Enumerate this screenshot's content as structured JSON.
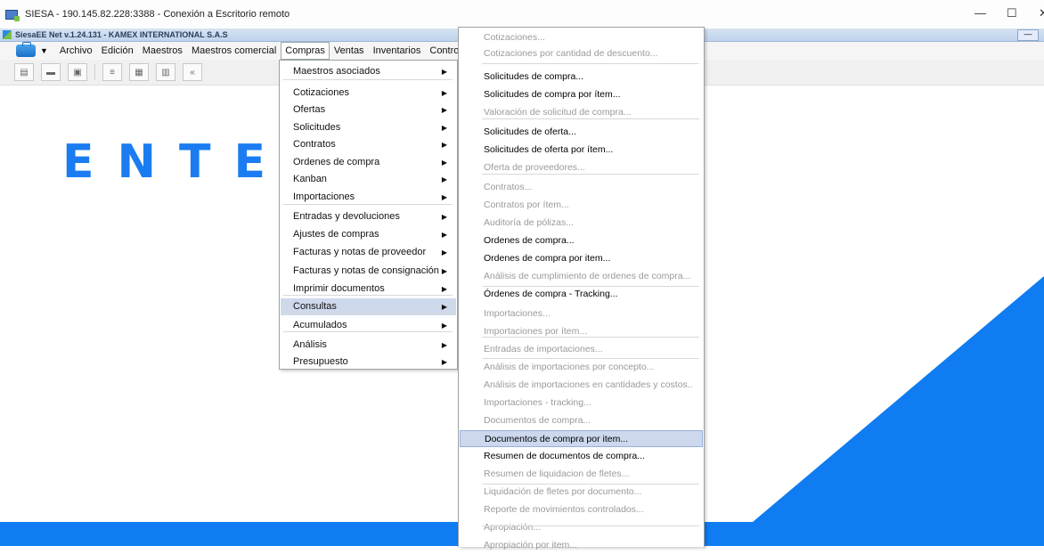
{
  "remote_title": "SIESA - 190.145.82.228:3388 - Conexión a Escritorio remoto",
  "window_controls": {
    "minimize": "—",
    "maximize": "☐",
    "close": "✕"
  },
  "app_title": "SiesaEE Net v.1.24.131 - KAMEX INTERNATIONAL S.A.S",
  "app_min": "—",
  "menubar": {
    "arrow": "▼",
    "items": [
      "Archivo",
      "Edición",
      "Maestros",
      "Maestros comercial",
      "Compras",
      "Ventas",
      "Inventarios",
      "Contro"
    ]
  },
  "toolbar": {
    "nav_back": "«"
  },
  "background_text": "ENTER",
  "compras_menu": [
    {
      "label": "Maestros asociados",
      "submenu": true
    },
    {
      "label": "Cotizaciones",
      "submenu": true
    },
    {
      "label": "Ofertas",
      "submenu": true
    },
    {
      "label": "Solicitudes",
      "submenu": true
    },
    {
      "label": "Contratos",
      "submenu": true
    },
    {
      "label": "Ordenes de compra",
      "submenu": true
    },
    {
      "label": "Kanban",
      "submenu": true
    },
    {
      "label": "Importaciones",
      "submenu": true
    },
    {
      "label": "Entradas y devoluciones",
      "submenu": true
    },
    {
      "label": "Ajustes de compras",
      "submenu": true
    },
    {
      "label": "Facturas y notas de proveedor",
      "submenu": true
    },
    {
      "label": "Facturas y notas de consignación",
      "submenu": true
    },
    {
      "label": "Imprimir documentos",
      "submenu": true
    },
    {
      "label": "Consultas",
      "submenu": true,
      "highlighted": true
    },
    {
      "label": "Acumulados",
      "submenu": true
    },
    {
      "label": "Análisis",
      "submenu": true
    },
    {
      "label": "Presupuesto",
      "submenu": true
    }
  ],
  "consultas_menu": [
    {
      "label": "Cotizaciones...",
      "enabled": false
    },
    {
      "label": "Cotizaciones por cantidad de descuento...",
      "enabled": false
    },
    {
      "label": "Solicitudes de compra...",
      "enabled": true
    },
    {
      "label": "Solicitudes de compra por ítem...",
      "enabled": true
    },
    {
      "label": "Valoración de solicitud de compra...",
      "enabled": false
    },
    {
      "label": "Solicitudes de oferta...",
      "enabled": true
    },
    {
      "label": "Solicitudes de oferta por ítem...",
      "enabled": true
    },
    {
      "label": "Oferta de proveedores...",
      "enabled": false
    },
    {
      "label": "Contratos...",
      "enabled": false
    },
    {
      "label": "Contratos por ítem...",
      "enabled": false
    },
    {
      "label": "Auditoría de pólizas...",
      "enabled": false
    },
    {
      "label": "Ordenes de compra...",
      "enabled": true
    },
    {
      "label": "Ordenes de compra por item...",
      "enabled": true
    },
    {
      "label": "Análisis de cumplimiento de ordenes de compra...",
      "enabled": false
    },
    {
      "label": "Órdenes de compra - Tracking...",
      "enabled": true
    },
    {
      "label": "Importaciones...",
      "enabled": false
    },
    {
      "label": "Importaciones por  ítem...",
      "enabled": false
    },
    {
      "label": "Entradas de importaciones...",
      "enabled": false
    },
    {
      "label": "Análisis de importaciones por concepto...",
      "enabled": false
    },
    {
      "label": "Análisis de importaciones en cantidades y costos..",
      "enabled": false
    },
    {
      "label": "Importaciones - tracking...",
      "enabled": false
    },
    {
      "label": "Documentos de compra...",
      "enabled": false
    },
    {
      "label": "Documentos de compra por item...",
      "enabled": true,
      "highlighted": true
    },
    {
      "label": "Resumen de documentos de compra...",
      "enabled": true
    },
    {
      "label": "Resumen de liquidacion de fletes...",
      "enabled": false
    },
    {
      "label": "Liquidación de fletes por documento...",
      "enabled": false
    },
    {
      "label": "Reporte de movimientos controlados...",
      "enabled": false
    },
    {
      "label": "Apropiación...",
      "enabled": false
    },
    {
      "label": "Apropiación por item...",
      "enabled": false
    }
  ]
}
